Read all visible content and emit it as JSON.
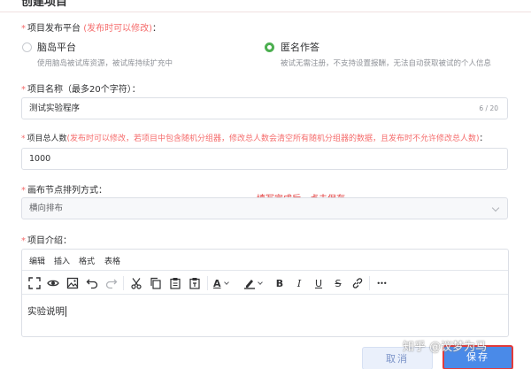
{
  "page": {
    "title": "创建项目"
  },
  "platform": {
    "label": "项目发布平台",
    "note": "(发布时可以修改)",
    "colon": "：",
    "options": [
      {
        "title": "脑岛平台",
        "desc": "使用脑岛被试库资源，被试库持续扩充中",
        "checked": false
      },
      {
        "title": "匿名作答",
        "desc": "被试无需注册，不支持设置报酬，无法自动获取被试的个人信息",
        "checked": true
      }
    ]
  },
  "project_name": {
    "label": "项目名称（最多20个字符）：",
    "value": "测试实验程序",
    "counter": "6 / 20"
  },
  "total": {
    "label": "项目总人数",
    "note": "(发布时可以修改，若项目中包含随机分组器，修改总人数会清空所有随机分组器的数据，且发布时不允许修改总人数)",
    "colon": "：",
    "value": "1000"
  },
  "layout": {
    "label": "画布节点排列方式：",
    "value": "横向排布"
  },
  "annotation": "填写完成后，点击保存",
  "intro": {
    "label": "项目介绍：",
    "menu": [
      "编辑",
      "插入",
      "格式",
      "表格"
    ],
    "content": "实验说明"
  },
  "toolbar_icons": [
    "fullscreen-icon",
    "preview-icon",
    "image-icon",
    "undo-icon",
    "redo-icon",
    "cut-icon",
    "copy-icon",
    "paste-icon",
    "paste-text-icon",
    "font-color-icon",
    "highlight-icon",
    "bold-icon",
    "italic-icon",
    "underline-icon",
    "strikethrough-icon",
    "link-icon",
    "more-icon"
  ],
  "toolbar_glyphs": {
    "font_color": "A",
    "bold": "B",
    "italic": "I",
    "underline": "U",
    "strike": "S",
    "more": "•••"
  },
  "buttons": {
    "cancel": "取消",
    "save": "保存"
  },
  "watermark": "知乎 @议梦为马",
  "colors": {
    "accent": "#4caf50",
    "warning": "#f56c6c",
    "primary": "#4a8ae8",
    "annotation": "#e23b3b"
  }
}
